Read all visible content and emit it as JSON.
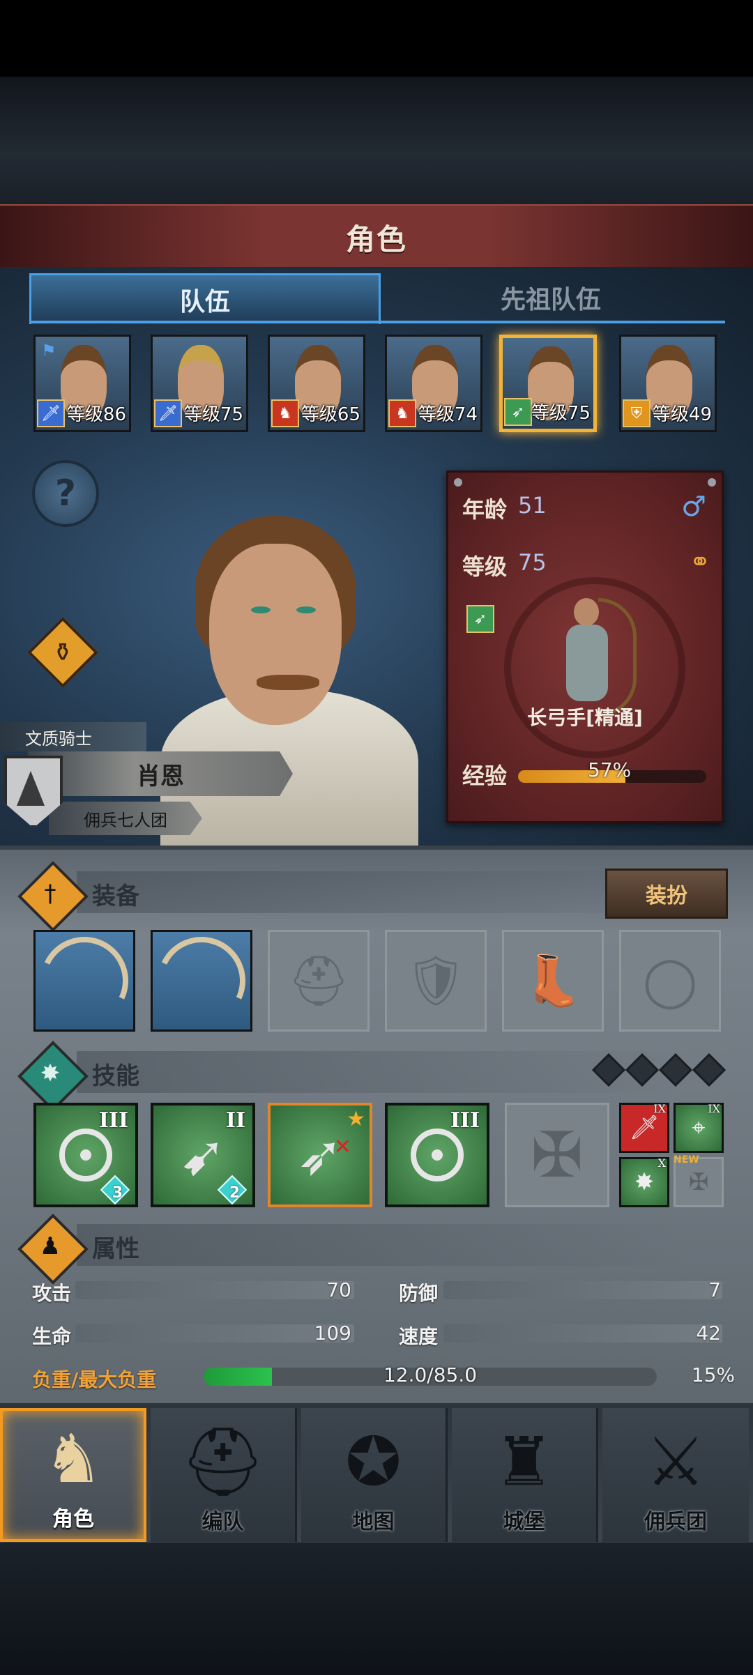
{
  "header": {
    "title": "角色"
  },
  "tabs": [
    {
      "label": "队伍",
      "active": true
    },
    {
      "label": "先祖队伍",
      "active": false
    }
  ],
  "heroes": [
    {
      "level": "等级86",
      "class_icon": "sword-icon",
      "class_color": "#3a6bd0",
      "flag": true
    },
    {
      "level": "等级75",
      "class_icon": "sword-icon",
      "class_color": "#3a6bd0"
    },
    {
      "level": "等级65",
      "class_icon": "horse-icon",
      "class_color": "#c9361f"
    },
    {
      "level": "等级74",
      "class_icon": "horse-icon",
      "class_color": "#c9361f"
    },
    {
      "level": "等级75",
      "class_icon": "bow-icon",
      "class_color": "#3c9a52",
      "selected": true
    },
    {
      "level": "等级49",
      "class_icon": "shield-icon",
      "class_color": "#e0951e"
    }
  ],
  "character": {
    "rank": "文质骑士",
    "name": "肖恩",
    "guild": "佣兵七人团"
  },
  "info_card": {
    "age_label": "年龄",
    "age": "51",
    "level_label": "等级",
    "level": "75",
    "gender_icon": "male-icon",
    "class_name": "长弓手[精通]",
    "exp_label": "经验",
    "exp_percent": "57%",
    "exp_fraction": 0.57
  },
  "equipment": {
    "title": "装备",
    "dress_button": "装扮",
    "slots": [
      "longbow",
      "longbow",
      "helmet-empty",
      "armor-empty",
      "boots-empty",
      "ring-empty"
    ]
  },
  "skills": {
    "title": "技能",
    "gems": 4,
    "items": [
      {
        "icon": "target-arrow-icon",
        "tier": "III",
        "badge": "3"
      },
      {
        "icon": "crossbow-icon",
        "tier": "II",
        "badge": "2"
      },
      {
        "icon": "archer-fall-icon",
        "star": true,
        "selected": true
      },
      {
        "icon": "target-crosshair-icon",
        "tier": "III"
      },
      {
        "icon": "empty-skill-slot",
        "empty": true
      }
    ],
    "passives": [
      {
        "icon": "sword-icon",
        "tier": "IX"
      },
      {
        "icon": "crosshair-icon",
        "tier": "IX"
      },
      {
        "icon": "burst-icon",
        "tier": "X"
      },
      {
        "icon": "cross-icon",
        "tag": "NEW"
      }
    ]
  },
  "attributes": {
    "title": "属性",
    "attack_label": "攻击",
    "attack": "70",
    "defense_label": "防御",
    "defense": "7",
    "hp_label": "生命",
    "hp": "109",
    "speed_label": "速度",
    "speed": "42",
    "load_label": "负重/最大负重",
    "load_value": "12.0/85.0",
    "load_percent": "15%",
    "load_fraction": 0.15
  },
  "nav": [
    {
      "label": "角色",
      "active": true
    },
    {
      "label": "编队"
    },
    {
      "label": "地图"
    },
    {
      "label": "城堡"
    },
    {
      "label": "佣兵团"
    }
  ]
}
